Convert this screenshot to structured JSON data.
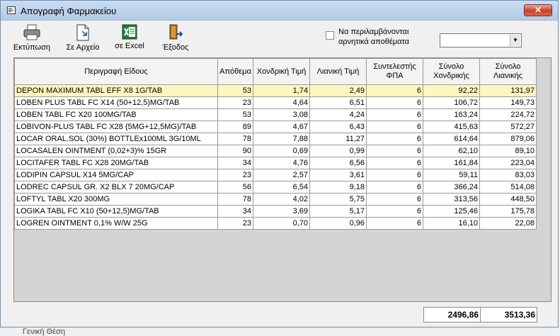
{
  "window": {
    "title": "Απογραφή Φαρμακείου",
    "close_label": "✕"
  },
  "toolbar": {
    "print_label": "Εκτύπωση",
    "file_label": "Σε Αρχείο",
    "excel_label": "σε Excel",
    "exit_label": "Έξοδος"
  },
  "option": {
    "negative_stock_label": "Να περιλαμβάνονται αρνητικά αποθέματα",
    "checked": false
  },
  "dropdown": {
    "value": ""
  },
  "table": {
    "columns": [
      "Περιγραφή Είδους",
      "Απόθεμα",
      "Χονδρική Τιμή",
      "Λιανική Τιμή",
      "Συντελεστής ΦΠΑ",
      "Σύνολο Χονδρικής",
      "Σύνολο Λιανικής"
    ],
    "rows": [
      [
        "DEPON MAXIMUM TABL EFF X8 1G/TAB",
        "53",
        "1,74",
        "2,49",
        "6",
        "92,22",
        "131,97"
      ],
      [
        "LOBEN PLUS TABL FC X14 (50+12,5)MG/TAB",
        "23",
        "4,64",
        "6,51",
        "6",
        "106,72",
        "149,73"
      ],
      [
        "LOBEN TABL FC X20 100MG/TAB",
        "53",
        "3,08",
        "4,24",
        "6",
        "163,24",
        "224,72"
      ],
      [
        "LOBIVON-PLUS TABL FC X28 (5MG+12,5MG)/TAB",
        "89",
        "4,67",
        "6,43",
        "6",
        "415,63",
        "572,27"
      ],
      [
        "LOCAR ORAL.SOL (30%) BOTTLEx100ML 3G/10ML",
        "78",
        "7,88",
        "11,27",
        "6",
        "614,64",
        "879,06"
      ],
      [
        "LOCASALEN OINTMENT (0,02+3)% 15GR",
        "90",
        "0,69",
        "0,99",
        "6",
        "62,10",
        "89,10"
      ],
      [
        "LOCITAFER TABL FC X28 20MG/TAB",
        "34",
        "4,76",
        "6,56",
        "6",
        "161,84",
        "223,04"
      ],
      [
        "LODIPIN CAPSUL X14 5MG/CAP",
        "23",
        "2,57",
        "3,61",
        "6",
        "59,11",
        "83,03"
      ],
      [
        "LODREC CAPSUL GR. X2 BLX 7 20MG/CAP",
        "56",
        "6,54",
        "9,18",
        "6",
        "366,24",
        "514,08"
      ],
      [
        "LOFTYL TABL X20 300MG",
        "78",
        "4,02",
        "5,75",
        "6",
        "313,56",
        "448,50"
      ],
      [
        "LOGIKA TABL FC X10 (50+12,5)MG/TAB",
        "34",
        "3,69",
        "5,17",
        "6",
        "125,46",
        "175,78"
      ],
      [
        "LOGREN OINTMENT 0,1% W/W 25G",
        "23",
        "0,70",
        "0,96",
        "6",
        "16,10",
        "22,08"
      ]
    ],
    "selected_row": 0
  },
  "totals": {
    "wholesale": "2496,86",
    "retail": "3513,36"
  },
  "background_text": "Γενική Θέση"
}
